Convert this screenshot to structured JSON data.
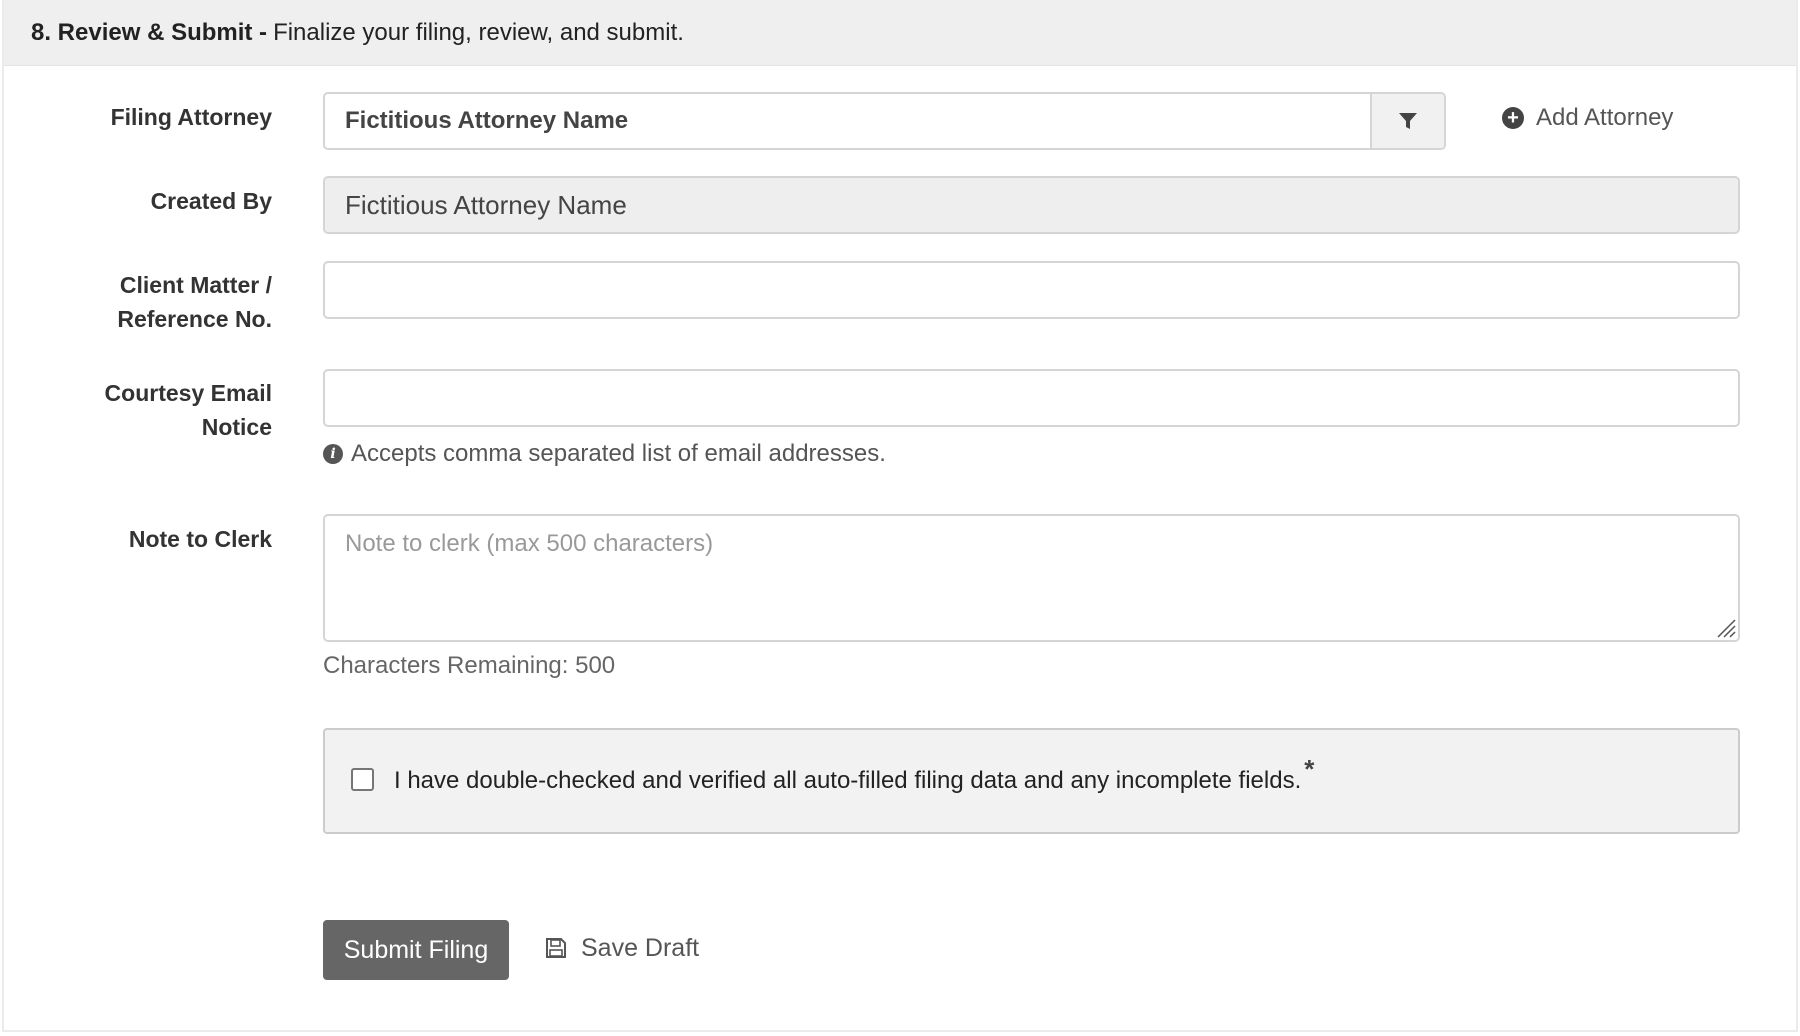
{
  "header": {
    "step_title": "8. Review & Submit -",
    "step_description": "Finalize your filing, review, and submit."
  },
  "filing_attorney": {
    "label": "Filing Attorney",
    "selected_value": "Fictitious Attorney Name",
    "filter_icon": "filter-icon",
    "add_label": "Add Attorney",
    "add_icon": "plus-circle-icon"
  },
  "created_by": {
    "label": "Created By",
    "value": "Fictitious Attorney Name"
  },
  "client_matter": {
    "label_line1": "Client Matter /",
    "label_line2": "Reference No.",
    "value": ""
  },
  "courtesy_email": {
    "label_line1": "Courtesy Email",
    "label_line2": "Notice",
    "value": "",
    "help_text": "Accepts comma separated list of email addresses.",
    "help_icon": "info-icon"
  },
  "note_to_clerk": {
    "label": "Note to Clerk",
    "placeholder": "Note to clerk (max 500 characters)",
    "value": "",
    "remaining_text": "Characters Remaining: 500"
  },
  "verification": {
    "checked": false,
    "label": "I have double-checked and verified all auto-filled filing data and any incomplete fields.",
    "required_marker": "*"
  },
  "actions": {
    "submit_label": "Submit Filing",
    "save_draft_label": "Save Draft",
    "save_draft_icon": "floppy-disk-icon"
  },
  "colors": {
    "header_bg": "#efefef",
    "submit_bg": "#666666",
    "readonly_bg": "#eeeeee",
    "verify_bg": "#f2f2f2"
  }
}
